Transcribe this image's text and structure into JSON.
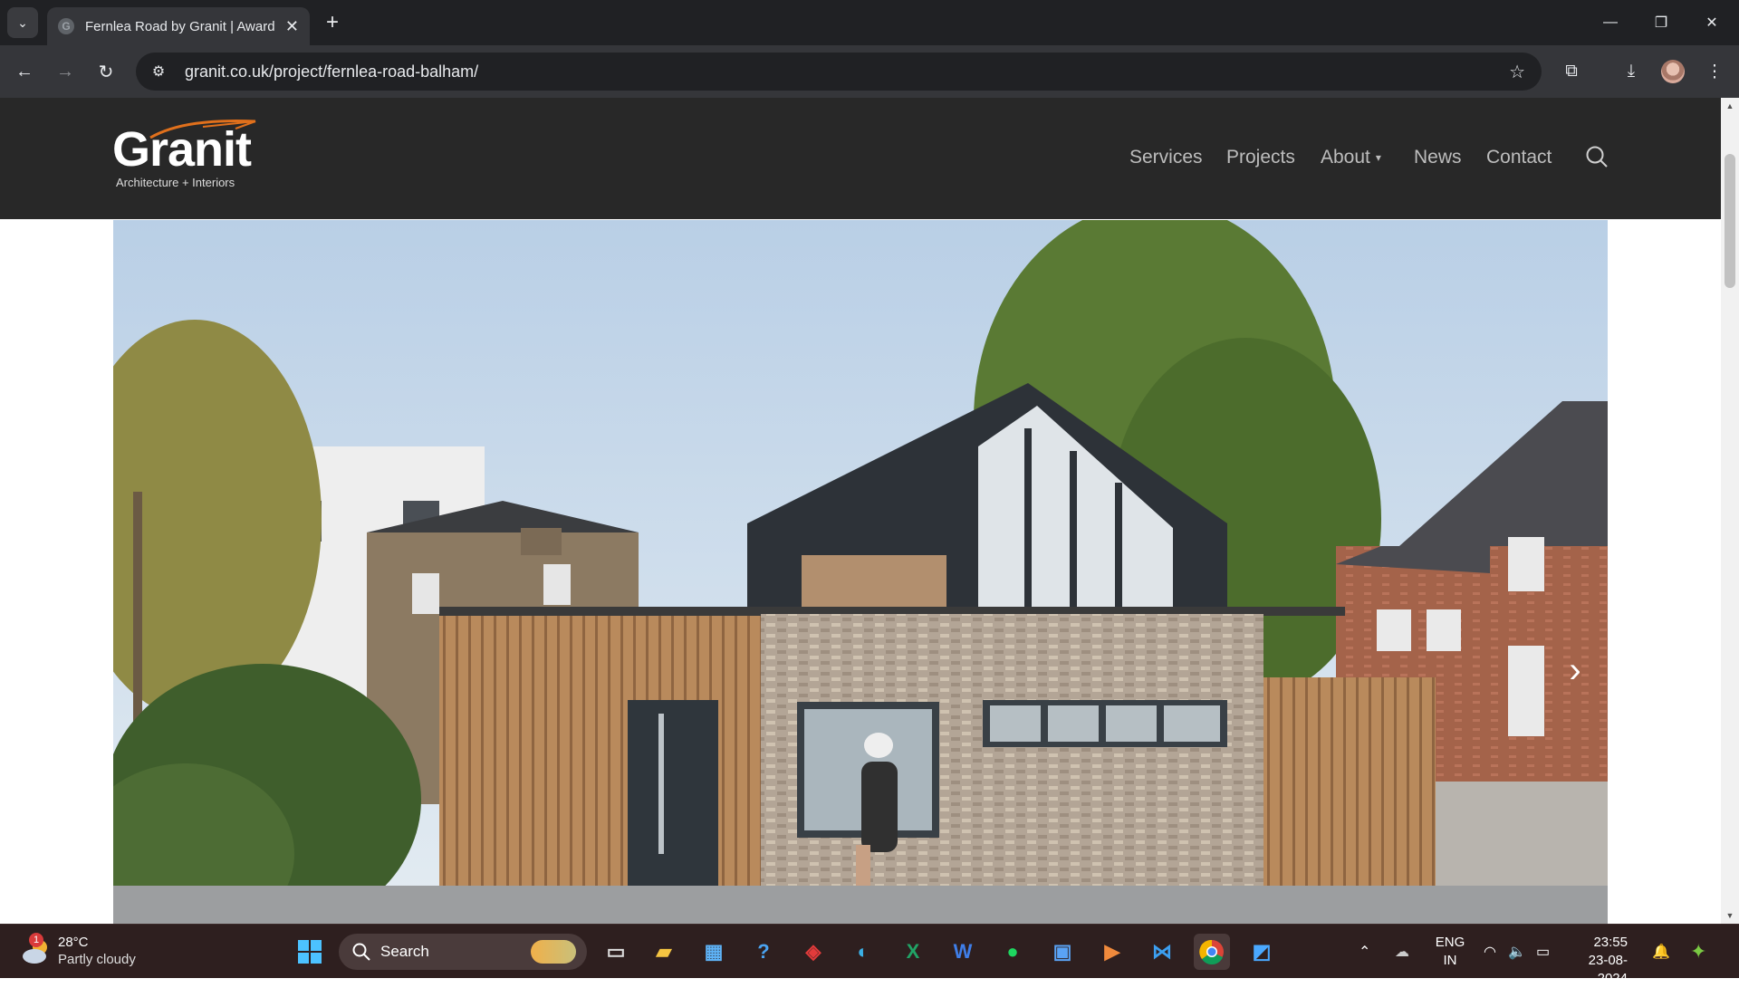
{
  "browser": {
    "tab_title": "Fernlea Road by Granit | Award",
    "tab_favicon_letter": "G",
    "url": "granit.co.uk/project/fernlea-road-balham/"
  },
  "site": {
    "logo_word": "Granit",
    "logo_tagline": "Architecture + Interiors",
    "nav": {
      "services": "Services",
      "projects": "Projects",
      "about": "About",
      "news": "News",
      "contact": "Contact"
    }
  },
  "taskbar": {
    "weather_temp": "28°C",
    "weather_condition": "Partly cloudy",
    "weather_badge": "1",
    "search_label": "Search",
    "lang_line1": "ENG",
    "lang_line2": "IN",
    "time": "23:55",
    "date": "23-08-2024"
  },
  "colors": {
    "header_bg": "#282828",
    "logo_accent": "#e0701c",
    "taskbar_bg": "#2e1f1f"
  }
}
